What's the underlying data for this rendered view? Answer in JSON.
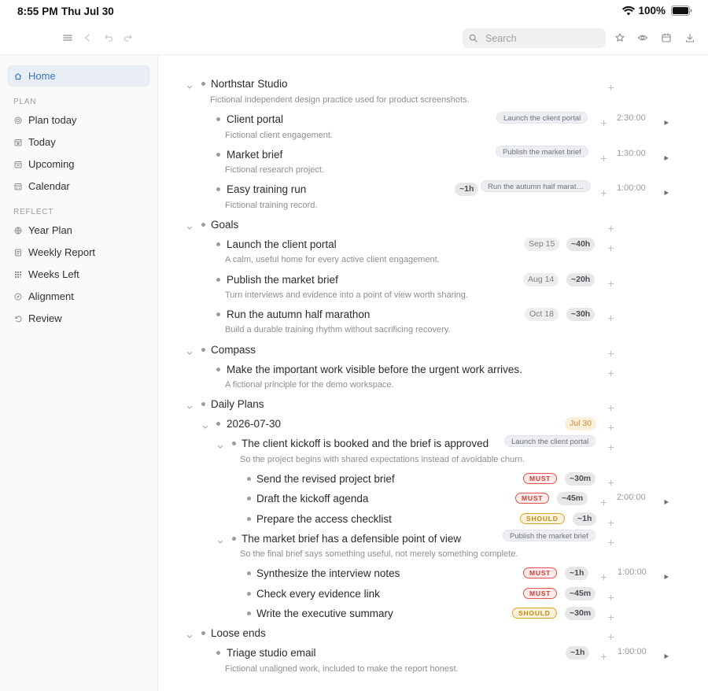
{
  "status_bar": {
    "time": "8:55 PM",
    "date": "Thu Jul 30",
    "battery": "100%"
  },
  "toolbar": {
    "search_placeholder": "Search"
  },
  "sidebar": {
    "home": "Home",
    "plan_section": "PLAN",
    "plan_items": [
      "Plan today",
      "Today",
      "Upcoming",
      "Calendar"
    ],
    "reflect_section": "REFLECT",
    "reflect_items": [
      "Year Plan",
      "Weekly Report",
      "Weeks Left",
      "Alignment",
      "Review"
    ]
  },
  "outline": {
    "northstar": {
      "title": "Northstar Studio",
      "note": "Fictional independent design practice used for product screenshots."
    },
    "client_portal": {
      "title": "Client portal",
      "note": "Fictional client engagement.",
      "tag": "Launch the client portal",
      "duration": "2:30:00"
    },
    "market_brief": {
      "title": "Market brief",
      "note": "Fictional research project.",
      "tag": "Publish the market brief",
      "duration": "1:30:00"
    },
    "training_run": {
      "title": "Easy training run",
      "note": "Fictional training record.",
      "estimate": "~1h",
      "tag": "Run the autumn half marat…",
      "duration": "1:00:00"
    },
    "goals": {
      "title": "Goals"
    },
    "goal_portal": {
      "title": "Launch the client portal",
      "note": "A calm, useful home for every active client engagement.",
      "date": "Sep 15",
      "estimate": "~40h"
    },
    "goal_brief": {
      "title": "Publish the market brief",
      "note": "Turn interviews and evidence into a point of view worth sharing.",
      "date": "Aug 14",
      "estimate": "~20h"
    },
    "goal_marathon": {
      "title": "Run the autumn half marathon",
      "note": "Build a durable training rhythm without sacrificing recovery.",
      "date": "Oct 18",
      "estimate": "~30h"
    },
    "compass": {
      "title": "Compass"
    },
    "compass_item": {
      "title": "Make the important work visible before the urgent work arrives.",
      "note": "A fictional principle for the demo workspace."
    },
    "daily_plans": {
      "title": "Daily Plans"
    },
    "day": {
      "title": "2026-07-30",
      "date": "Jul 30"
    },
    "outcome_kickoff": {
      "title": "The client kickoff is booked and the brief is approved",
      "note": "So the project begins with shared expectations instead of avoidable churn.",
      "tag": "Launch the client portal"
    },
    "task_revised": {
      "title": "Send the revised project brief",
      "priority": "MUST",
      "estimate": "~30m"
    },
    "task_agenda": {
      "title": "Draft the kickoff agenda",
      "priority": "MUST",
      "estimate": "~45m",
      "duration": "2:00:00"
    },
    "task_checklist": {
      "title": "Prepare the access checklist",
      "priority": "SHOULD",
      "estimate": "~1h"
    },
    "outcome_brief": {
      "title": "The market brief has a defensible point of view",
      "note": "So the final brief says something useful, not merely something complete.",
      "tag": "Publish the market brief"
    },
    "task_synth": {
      "title": "Synthesize the interview notes",
      "priority": "MUST",
      "estimate": "~1h",
      "duration": "1:00:00"
    },
    "task_evidence": {
      "title": "Check every evidence link",
      "priority": "MUST",
      "estimate": "~45m"
    },
    "task_summary": {
      "title": "Write the executive summary",
      "priority": "SHOULD",
      "estimate": "~30m"
    },
    "loose_ends": {
      "title": "Loose ends"
    },
    "triage": {
      "title": "Triage studio email",
      "note": "Fictional unaligned work, included to make the report honest.",
      "estimate": "~1h",
      "duration": "1:00:00"
    }
  },
  "colors": {
    "accent": "#3d73c7",
    "must": "#cc3d36",
    "should": "#c58914",
    "today": "#c88a35"
  }
}
